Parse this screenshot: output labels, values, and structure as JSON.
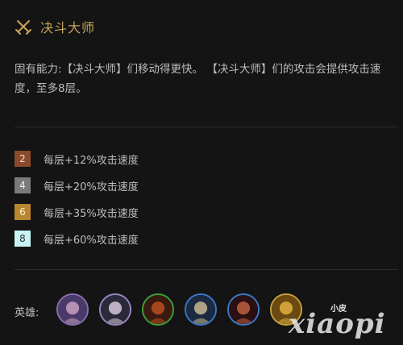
{
  "trait": {
    "icon": "crossed-swords-icon",
    "title": "决斗大师"
  },
  "description": "固有能力:【决斗大师】们移动得更快。 【决斗大师】们的攻击会提供攻击速度，至多8层。",
  "tiers": [
    {
      "level": "2",
      "text": "每层+12%攻击速度",
      "color": "#8b4a2b",
      "text_color": "#f0e0d0"
    },
    {
      "level": "4",
      "text": "每层+20%攻击速度",
      "color": "#7a7a7a",
      "text_color": "#f0f0f0"
    },
    {
      "level": "6",
      "text": "每层+35%攻击速度",
      "color": "#b8862f",
      "text_color": "#fff3d6"
    },
    {
      "level": "8",
      "text": "每层+60%攻击速度",
      "color": "#c8f4f4",
      "text_color": "#333333"
    }
  ],
  "heroes": {
    "label": "英雄:",
    "avatars": [
      {
        "name": "hero-1",
        "border": "#8a6fb0",
        "bg": "#4a3a6a",
        "face": "#c9a0c0"
      },
      {
        "name": "hero-2",
        "border": "#9a86c0",
        "bg": "#2a2a3a",
        "face": "#d8c8d8"
      },
      {
        "name": "hero-3",
        "border": "#3aa03a",
        "bg": "#3a1a10",
        "face": "#b85020"
      },
      {
        "name": "hero-4",
        "border": "#3a78c8",
        "bg": "#1a2a40",
        "face": "#c8b890"
      },
      {
        "name": "hero-5",
        "border": "#3a78c8",
        "bg": "#2a1010",
        "face": "#c06040"
      },
      {
        "name": "hero-6",
        "border": "#c8a040",
        "bg": "#6a4a10",
        "face": "#e0b040"
      }
    ]
  },
  "watermark": {
    "small": "小皮",
    "main": "xiaopi"
  }
}
